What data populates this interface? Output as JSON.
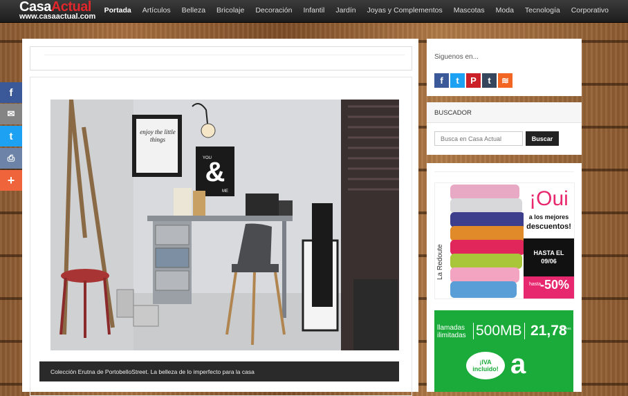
{
  "logo": {
    "name_part1": "Casa",
    "name_part2": "Actual",
    "url": "www.casaactual.com"
  },
  "nav": {
    "items": [
      "Portada",
      "Artículos",
      "Belleza",
      "Bricolaje",
      "Decoración",
      "Infantil",
      "Jardín",
      "Joyas y Complementos",
      "Mascotas",
      "Moda",
      "Tecnología",
      "Corporativo"
    ],
    "active": "Portada"
  },
  "share": {
    "facebook": "f",
    "email": "✉",
    "twitter": "t",
    "print": "⎙",
    "more": "+"
  },
  "article": {
    "caption": "Colección Erutna de PortobelloStreet. La belleza de lo imperfecto para la casa",
    "photo_poster1": "enjoy the little things",
    "photo_poster2": "&",
    "photo_poster2_small1": "YOU",
    "photo_poster2_small2": "ME"
  },
  "sidebar": {
    "follow_title": "Siguenos en...",
    "social": [
      {
        "name": "facebook",
        "glyph": "f",
        "color": "#3b5998"
      },
      {
        "name": "twitter",
        "glyph": "t",
        "color": "#1da1f2"
      },
      {
        "name": "pinterest",
        "glyph": "P",
        "color": "#cb2027"
      },
      {
        "name": "tumblr",
        "glyph": "t",
        "color": "#35465c"
      },
      {
        "name": "rss",
        "glyph": "≋",
        "color": "#f26522"
      }
    ],
    "search_title": "BUSCADOR",
    "search_placeholder": "Busca en Casa Actual",
    "search_button": "Buscar",
    "ad1": {
      "brand": "La Redoute",
      "headline": "¡Oui",
      "sub1": "a los mejores",
      "sub2": "descuentos!",
      "date1": "HASTA EL",
      "date2": "09/06",
      "discount_label": "hasta",
      "discount": "-50%"
    },
    "ad2": {
      "line1": "llamadas",
      "line2": "ilimitadas",
      "data": "500MB",
      "price": "21,78",
      "price_unit": "€/mes",
      "iva": "¡IVA incluido!",
      "logo_letter": "a"
    }
  },
  "colors": {
    "accent_red": "#e0282c",
    "topbar": "#222222",
    "green_ad": "#1aab3a",
    "pink_ad": "#e8286e"
  }
}
